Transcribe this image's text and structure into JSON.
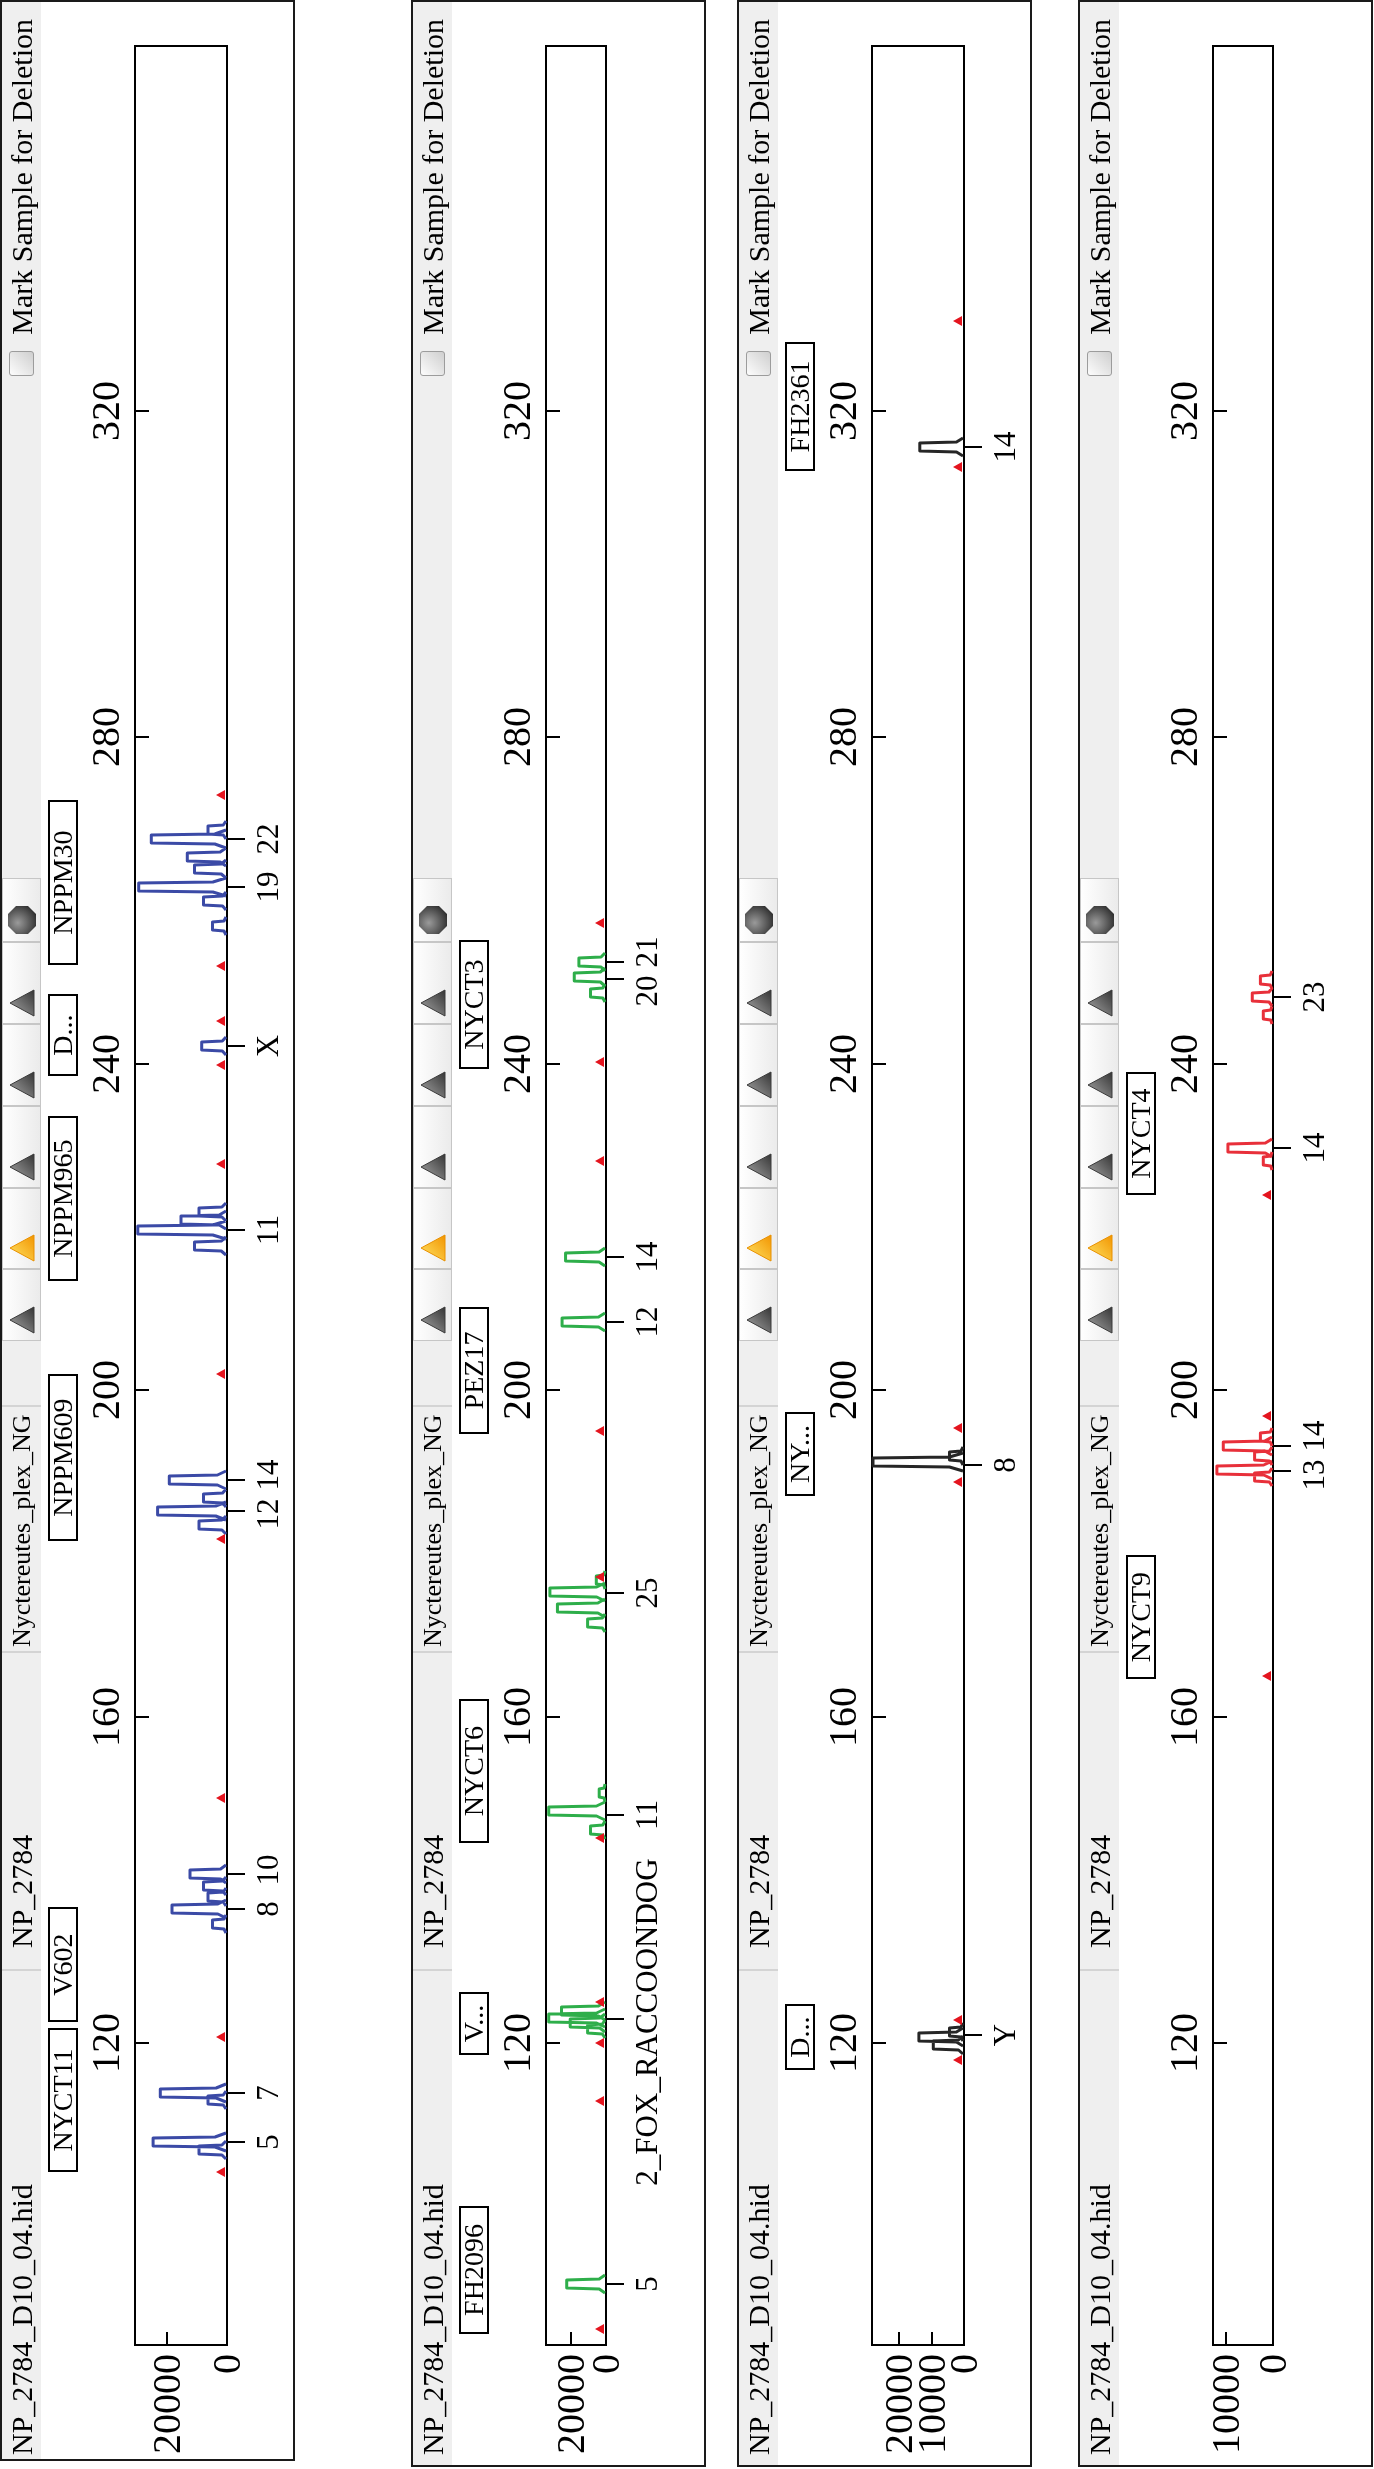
{
  "panels": [
    {
      "header": {
        "file_name": "NP_2784_D10_04.hid",
        "sample_name": "NP_2784",
        "panel_name": "Nyctereutes_plex_NG"
      },
      "toolbar": [
        {
          "kind": "triangle",
          "selected": false
        },
        {
          "kind": "triangle",
          "selected": true
        },
        {
          "kind": "triangle",
          "selected": false
        },
        {
          "kind": "triangle",
          "selected": false
        },
        {
          "kind": "triangle",
          "selected": false
        },
        {
          "kind": "octagon",
          "selected": false
        }
      ],
      "mark_for_deletion": {
        "label": "Mark Sample for Deletion",
        "checked": false
      },
      "color": "#3b4aa6",
      "markers": [
        "NYCT11",
        "V602",
        "NPPM609",
        "NPPM965",
        "D...",
        "NPPM30"
      ],
      "x_axis_labels": [
        "120",
        "160",
        "200",
        "240",
        "280",
        "320"
      ],
      "y_axis_labels": [
        "20000",
        "0"
      ],
      "alleles": [
        "5",
        "7",
        "8",
        "10",
        "12",
        "14",
        "11",
        "X",
        "19",
        "22"
      ]
    },
    {
      "header": {
        "file_name": "NP_2784_D10_04.hid",
        "sample_name": "NP_2784",
        "panel_name": "Nyctereutes_plex_NG"
      },
      "toolbar": [
        {
          "kind": "triangle",
          "selected": false
        },
        {
          "kind": "triangle",
          "selected": true
        },
        {
          "kind": "triangle",
          "selected": false
        },
        {
          "kind": "triangle",
          "selected": false
        },
        {
          "kind": "triangle",
          "selected": false
        },
        {
          "kind": "octagon",
          "selected": false
        }
      ],
      "mark_for_deletion": {
        "label": "Mark Sample for Deletion",
        "checked": false
      },
      "color": "#2eae4a",
      "markers": [
        "FH2096",
        "V...",
        "NYCT6",
        "PEZ17",
        "NYCT3"
      ],
      "x_axis_labels": [
        "120",
        "160",
        "200",
        "240",
        "280",
        "320"
      ],
      "y_axis_labels": [
        "20000",
        "0"
      ],
      "alleles": [
        "5",
        "2_FOX_RACCOONDOG",
        "11",
        "25",
        "12",
        "14",
        "20",
        "21"
      ]
    },
    {
      "header": {
        "file_name": "NP_2784_D10_04.hid",
        "sample_name": "NP_2784",
        "panel_name": "Nyctereutes_plex_NG"
      },
      "toolbar": [
        {
          "kind": "triangle",
          "selected": false
        },
        {
          "kind": "triangle",
          "selected": true
        },
        {
          "kind": "triangle",
          "selected": false
        },
        {
          "kind": "triangle",
          "selected": false
        },
        {
          "kind": "triangle",
          "selected": false
        },
        {
          "kind": "octagon",
          "selected": false
        }
      ],
      "mark_for_deletion": {
        "label": "Mark Sample for Deletion",
        "checked": false
      },
      "color": "#262626",
      "markers": [
        "D...",
        "NY...",
        "FH2361"
      ],
      "x_axis_labels": [
        "120",
        "160",
        "200",
        "240",
        "280",
        "320"
      ],
      "y_axis_labels": [
        "20000",
        "10000",
        "0"
      ],
      "alleles": [
        "Y",
        "8",
        "14"
      ]
    },
    {
      "header": {
        "file_name": "NP_2784_D10_04.hid",
        "sample_name": "NP_2784",
        "panel_name": "Nyctereutes_plex_NG"
      },
      "toolbar": [
        {
          "kind": "triangle",
          "selected": false
        },
        {
          "kind": "triangle",
          "selected": true
        },
        {
          "kind": "triangle",
          "selected": false
        },
        {
          "kind": "triangle",
          "selected": false
        },
        {
          "kind": "triangle",
          "selected": false
        },
        {
          "kind": "octagon",
          "selected": false
        }
      ],
      "mark_for_deletion": {
        "label": "Mark Sample for Deletion",
        "checked": false
      },
      "color": "#e8303a",
      "markers": [
        "NYCT9",
        "NYCT4"
      ],
      "x_axis_labels": [
        "120",
        "160",
        "200",
        "240",
        "280",
        "320"
      ],
      "y_axis_labels": [
        "10000",
        "0"
      ],
      "alleles": [
        "13",
        "14",
        "14",
        "23"
      ]
    }
  ]
}
